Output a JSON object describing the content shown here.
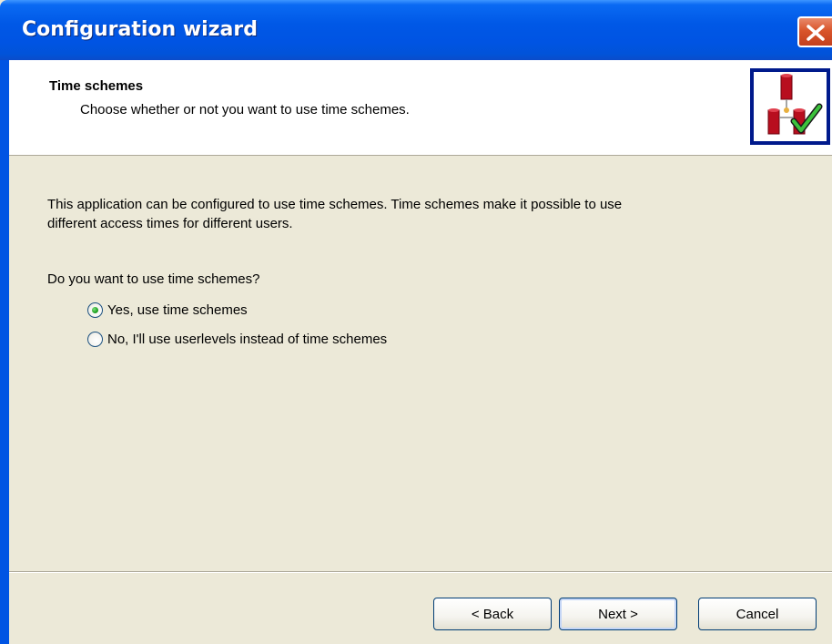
{
  "window": {
    "title": "Configuration wizard"
  },
  "header": {
    "title": "Time schemes",
    "subtitle": "Choose whether or not you want to use time schemes."
  },
  "body": {
    "description_line1": "This application can be configured to use time schemes. Time schemes make it possible to use",
    "description_line2": "different access times for different users.",
    "question": "Do you want to use time schemes?",
    "options": [
      {
        "label": "Yes, use time schemes",
        "checked": true
      },
      {
        "label": "No, I'll use userlevels instead of time schemes",
        "checked": false
      }
    ]
  },
  "buttons": {
    "back": "< Back",
    "next": "Next >",
    "cancel": "Cancel"
  },
  "icons": {
    "close": "close-icon",
    "wizard": "wizard-icon"
  },
  "colors": {
    "titlebar": "#0054e3",
    "background": "#ece9d8",
    "close": "#d9552b"
  }
}
